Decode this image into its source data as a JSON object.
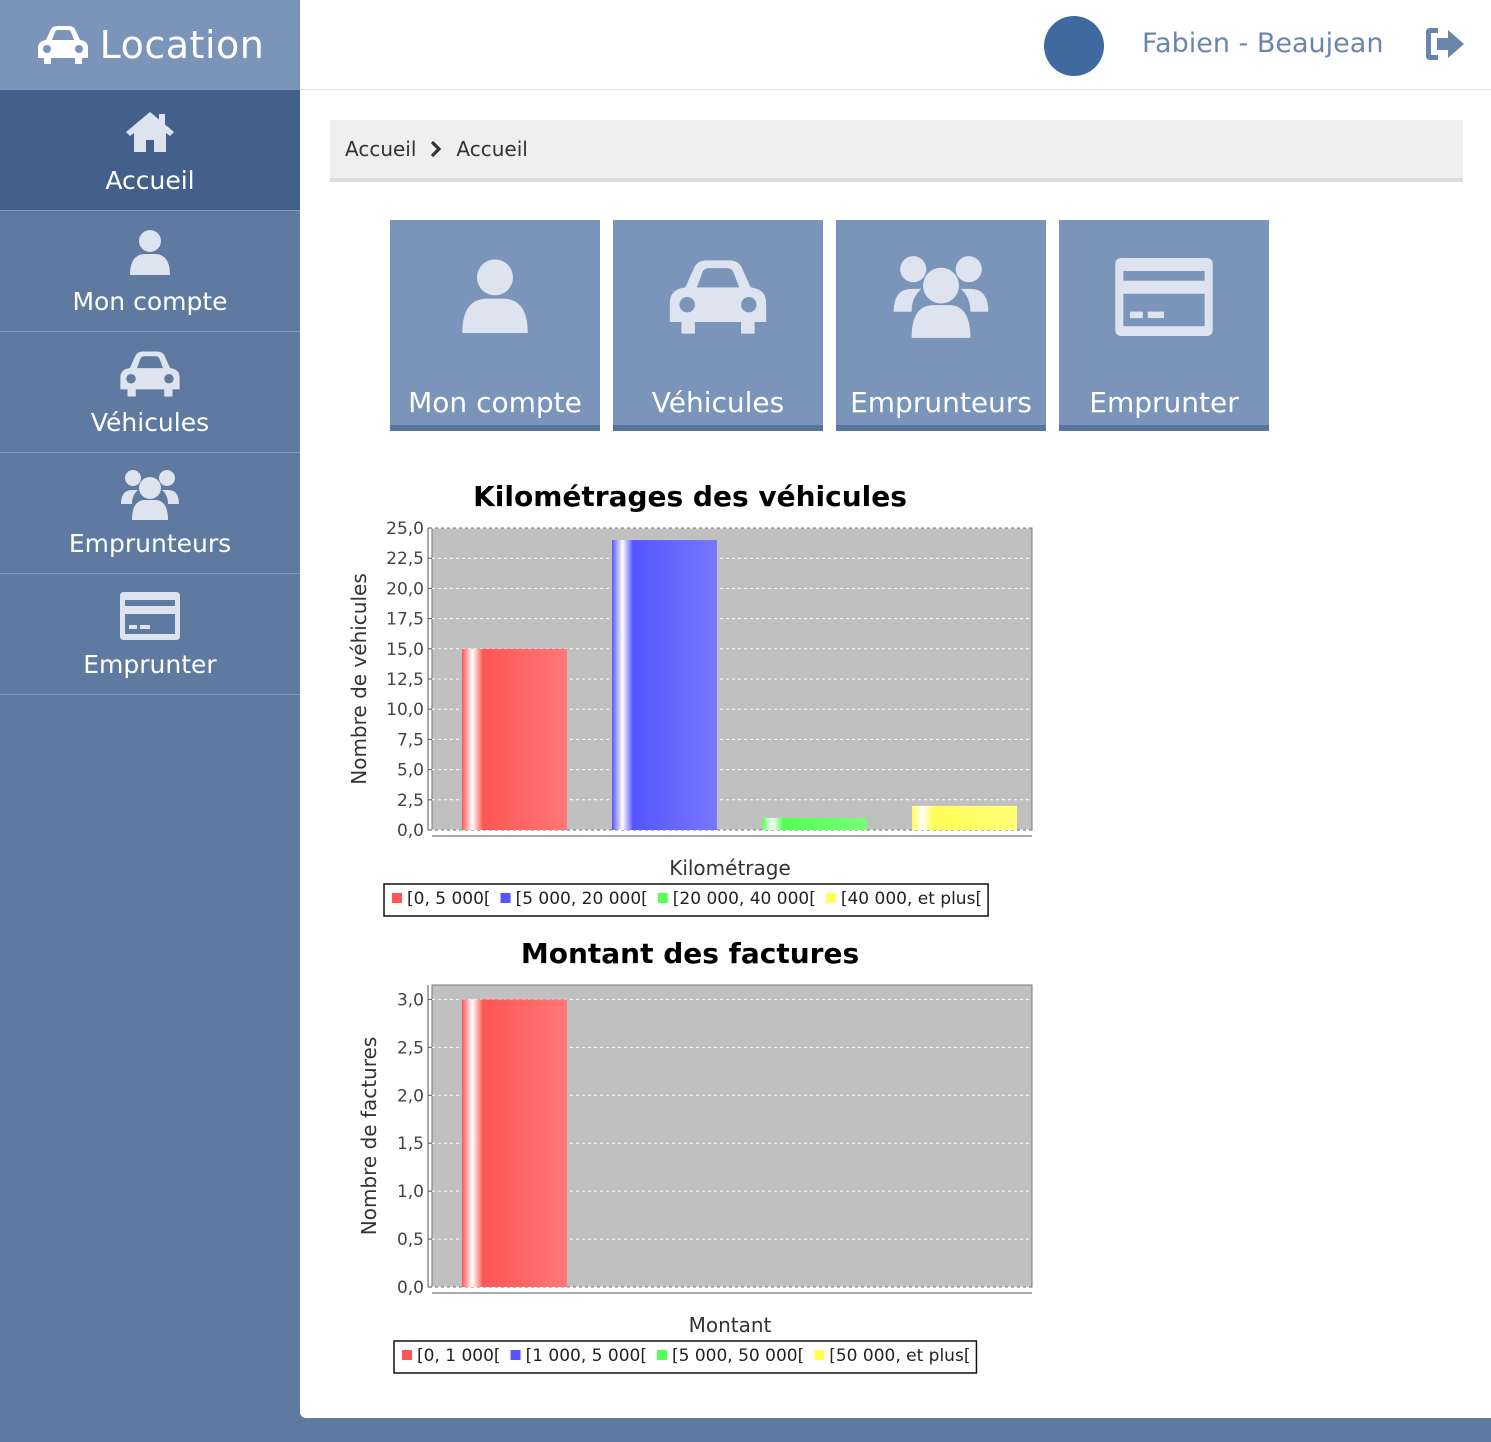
{
  "brand": {
    "title": "Location"
  },
  "sidebar": {
    "items": [
      {
        "label": "Accueil",
        "icon": "home-icon",
        "active": true
      },
      {
        "label": "Mon compte",
        "icon": "user-icon",
        "active": false
      },
      {
        "label": "Véhicules",
        "icon": "car-icon",
        "active": false
      },
      {
        "label": "Emprunteurs",
        "icon": "users-icon",
        "active": false
      },
      {
        "label": "Emprunter",
        "icon": "credit-card-icon",
        "active": false
      }
    ]
  },
  "header": {
    "username": "Fabien - Beaujean",
    "avatar_color": "#3f6aa0",
    "logout_icon": "logout-icon"
  },
  "breadcrumb": [
    "Accueil",
    "Accueil"
  ],
  "tiles": [
    {
      "label": "Mon compte",
      "icon": "user-icon"
    },
    {
      "label": "Véhicules",
      "icon": "car-icon"
    },
    {
      "label": "Emprunteurs",
      "icon": "users-icon"
    },
    {
      "label": "Emprunter",
      "icon": "credit-card-icon"
    }
  ],
  "colors": {
    "sidebar": "#5f7aa0",
    "brand_bg": "#7b94ba",
    "active": "#43608a",
    "tile": "#7b94ba",
    "plot_bg": "#c0c0c0"
  },
  "chart_data": [
    {
      "type": "bar",
      "title": "Kilométrages des véhicules",
      "xlabel": "Kilométrage",
      "ylabel": "Nombre de véhicules",
      "ylim": [
        0,
        25
      ],
      "yticks": [
        "0,0",
        "2,5",
        "5,0",
        "7,5",
        "10,0",
        "12,5",
        "15,0",
        "17,5",
        "20,0",
        "22,5",
        "25,0"
      ],
      "ytick_values": [
        0,
        2.5,
        5,
        7.5,
        10,
        12.5,
        15,
        17.5,
        20,
        22.5,
        25
      ],
      "grid": true,
      "legend_position": "bottom",
      "series": [
        {
          "name": "[0, 5 000[",
          "color": "#ff5555",
          "value": 15
        },
        {
          "name": "[5 000, 20 000[",
          "color": "#5555ff",
          "value": 24
        },
        {
          "name": "[20 000, 40 000[",
          "color": "#55ff55",
          "value": 1
        },
        {
          "name": "[40 000, et plus[",
          "color": "#ffff55",
          "value": 2
        }
      ]
    },
    {
      "type": "bar",
      "title": "Montant des factures",
      "xlabel": "Montant",
      "ylabel": "Nombre de factures",
      "ylim": [
        0,
        3.15
      ],
      "yticks": [
        "0,0",
        "0,5",
        "1,0",
        "1,5",
        "2,0",
        "2,5",
        "3,0"
      ],
      "ytick_values": [
        0,
        0.5,
        1,
        1.5,
        2,
        2.5,
        3
      ],
      "grid": true,
      "legend_position": "bottom",
      "series": [
        {
          "name": "[0, 1 000[",
          "color": "#ff5555",
          "value": 3
        },
        {
          "name": "[1 000, 5 000[",
          "color": "#5555ff",
          "value": 0
        },
        {
          "name": "[5 000, 50 000[",
          "color": "#55ff55",
          "value": 0
        },
        {
          "name": "[50 000, et plus[",
          "color": "#ffff55",
          "value": 0
        }
      ]
    }
  ]
}
